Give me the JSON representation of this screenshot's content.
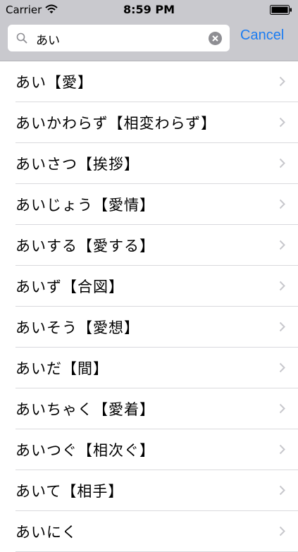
{
  "status_bar": {
    "carrier": "Carrier",
    "time": "8:59 PM"
  },
  "search": {
    "query": "あい",
    "cancel_label": "Cancel"
  },
  "results": [
    {
      "label": "あい【愛】"
    },
    {
      "label": "あいかわらず【相変わらず】"
    },
    {
      "label": "あいさつ【挨拶】"
    },
    {
      "label": "あいじょう【愛情】"
    },
    {
      "label": "あいする【愛する】"
    },
    {
      "label": "あいず【合図】"
    },
    {
      "label": "あいそう【愛想】"
    },
    {
      "label": "あいだ【間】"
    },
    {
      "label": "あいちゃく【愛着】"
    },
    {
      "label": "あいつぐ【相次ぐ】"
    },
    {
      "label": "あいて【相手】"
    },
    {
      "label": "あいにく"
    }
  ],
  "colors": {
    "accent": "#1b7cf2",
    "search_bar_bg": "#c9c9ce",
    "separator": "#d9d9dd"
  }
}
